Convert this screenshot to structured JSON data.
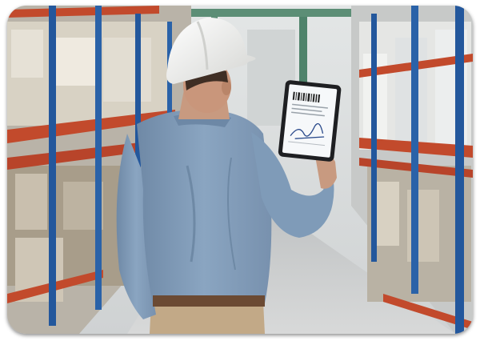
{
  "scene": {
    "subject": "warehouse-worker-with-tablet",
    "colors": {
      "hard_hat": "#f1f1ef",
      "shirt": "#7f9bb8",
      "trousers": "#c2a987",
      "belt": "#6b4a33",
      "rack_upright": "#23579c",
      "rack_beam": "#c24a2c",
      "floor": "#c9cbcc",
      "back_wall": "#e7e9ea",
      "tablet_frame": "#1e1f22",
      "tablet_screen": "#f6f8fa"
    },
    "icons": [
      "barcode-icon",
      "signature-icon"
    ]
  }
}
